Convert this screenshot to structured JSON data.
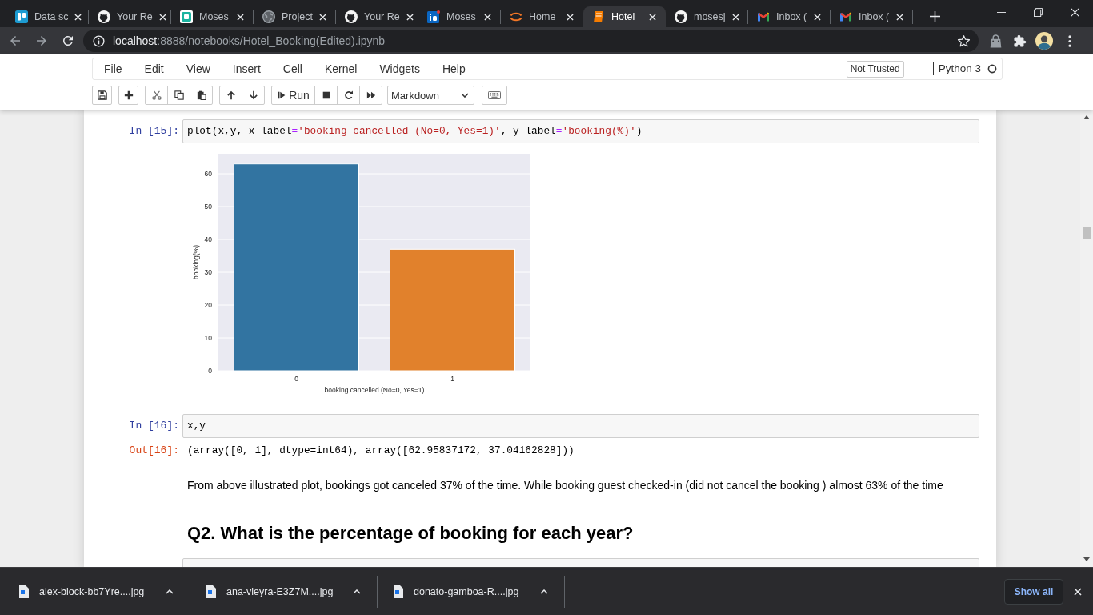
{
  "browser": {
    "tabs": [
      {
        "title": "Data sc",
        "kind": "board",
        "selected": false
      },
      {
        "title": "Your Re",
        "kind": "cat",
        "selected": false
      },
      {
        "title": "Moses",
        "kind": "s-tile",
        "selected": false
      },
      {
        "title": "Project",
        "kind": "globe",
        "selected": false
      },
      {
        "title": "Your Re",
        "kind": "cat",
        "selected": false
      },
      {
        "title": "Moses",
        "kind": "in-tile",
        "selected": false
      },
      {
        "title": "Home",
        "kind": "arcs",
        "selected": false
      },
      {
        "title": "Hotel_",
        "kind": "book",
        "selected": true
      },
      {
        "title": "mosesj",
        "kind": "cat",
        "selected": false
      },
      {
        "title": "Inbox (",
        "kind": "mail",
        "selected": false
      },
      {
        "title": "Inbox (",
        "kind": "mail",
        "selected": false
      }
    ],
    "address": {
      "host": "localhost",
      "path": ":8888/notebooks/Hotel_Booking(Edited).ipynb"
    }
  },
  "notebook": {
    "menu": [
      "File",
      "Edit",
      "View",
      "Insert",
      "Cell",
      "Kernel",
      "Widgets",
      "Help"
    ],
    "trust": "Not Trusted",
    "kernel": {
      "name": "Python 3",
      "busy": false
    },
    "toolbar": {
      "run": "Run",
      "cell_type": "Markdown"
    },
    "cells": [
      {
        "kind": "code",
        "prompt": "In [15]:",
        "tokens": [
          {
            "text": "plot(x,y, x_label",
            "kind": "plain"
          },
          {
            "text": "=",
            "kind": "operator"
          },
          {
            "text": "'booking cancelled (No=0, Yes=1)'",
            "kind": "string"
          },
          {
            "text": ", y_label",
            "kind": "plain"
          },
          {
            "text": "=",
            "kind": "operator"
          },
          {
            "text": "'booking(%)'",
            "kind": "string"
          },
          {
            "text": ")",
            "kind": "plain"
          }
        ],
        "output": {
          "kind": "chart",
          "chart_data": {
            "type": "bar",
            "xlabel": "booking cancelled (No=0, Yes=1)",
            "ylabel": "booking(%)",
            "categories": [
              "0",
              "1"
            ],
            "series": [
              {
                "color": "#3274a1",
                "values": [
                  63,
                  null
                ]
              },
              {
                "color": "#e1812c",
                "values": [
                  null,
                  37
                ]
              }
            ],
            "stacked": true,
            "grid": true,
            "ylim": [
              0,
              66.1
            ],
            "yticks": [
              0,
              10,
              20,
              30,
              40,
              50,
              60
            ]
          }
        }
      },
      {
        "kind": "code",
        "prompt": "In [16]:",
        "tokens": [
          {
            "text": "x,y",
            "kind": "plain"
          }
        ],
        "output": {
          "kind": "text",
          "prompt": "Out[16]:",
          "text": "(array([0, 1], dtype=int64), array([62.95837172, 37.04162828]))"
        }
      },
      {
        "kind": "markdown",
        "text": "From above illustrated plot, bookings got canceled 37% of the time. While booking guest checked-in (did not cancel the booking ) almost 63% of the time"
      },
      {
        "kind": "heading",
        "text": "Q2. What is the percentage of booking for each year?"
      },
      {
        "kind": "code"
      }
    ]
  },
  "downloads": {
    "items": [
      "alex-block-bb7Yre....jpg",
      "ana-vieyra-E3Z7M....jpg",
      "donato-gamboa-R....jpg"
    ],
    "show_all": "Show all"
  }
}
